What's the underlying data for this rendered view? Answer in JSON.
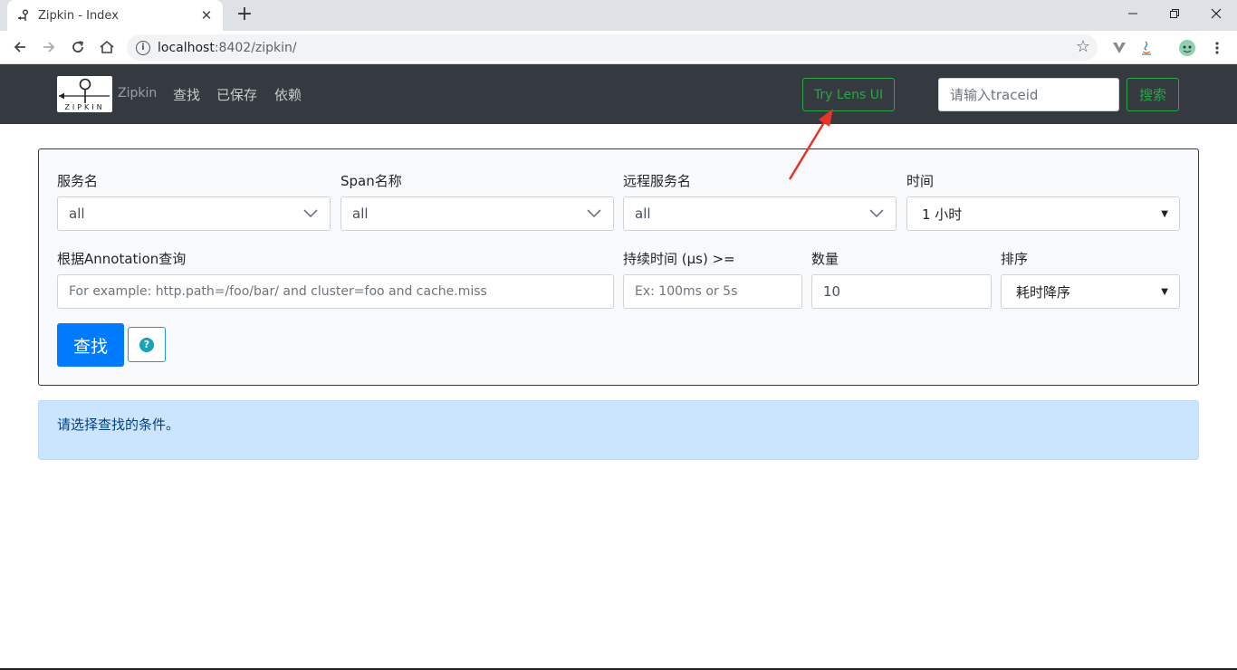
{
  "browser": {
    "tab_title": "Zipkin - Index",
    "tab_close": "✕",
    "new_tab": "+",
    "url_host": "localhost",
    "url_rest": ":8402/zipkin/"
  },
  "navbar": {
    "brand_text": "Zipkin",
    "logo_text": "ZIPKIN",
    "links": [
      "查找",
      "已保存",
      "依赖"
    ],
    "lens_button": "Try Lens UI",
    "traceid_placeholder": "请输入traceid",
    "search_button": "搜索"
  },
  "form": {
    "service_label": "服务名",
    "service_value": "all",
    "span_label": "Span名称",
    "span_value": "all",
    "remote_label": "远程服务名",
    "remote_value": "all",
    "time_label": "时间",
    "time_value": "1 小时",
    "annotation_label": "根据Annotation查询",
    "annotation_placeholder": "For example: http.path=/foo/bar/ and cluster=foo and cache.miss",
    "duration_label": "持续时间 (μs) >=",
    "duration_placeholder": "Ex: 100ms or 5s",
    "limit_label": "数量",
    "limit_value": "10",
    "sort_label": "排序",
    "sort_value": "耗时降序",
    "find_button": "查找",
    "help_glyph": "?"
  },
  "alert": {
    "message": "请选择查找的条件。"
  },
  "colors": {
    "navbar_bg": "#343a40",
    "success": "#28a745",
    "primary": "#007bff",
    "info": "#17a2b8",
    "alert_bg": "#cce5ff",
    "annotation_arrow": "#e8332a"
  }
}
